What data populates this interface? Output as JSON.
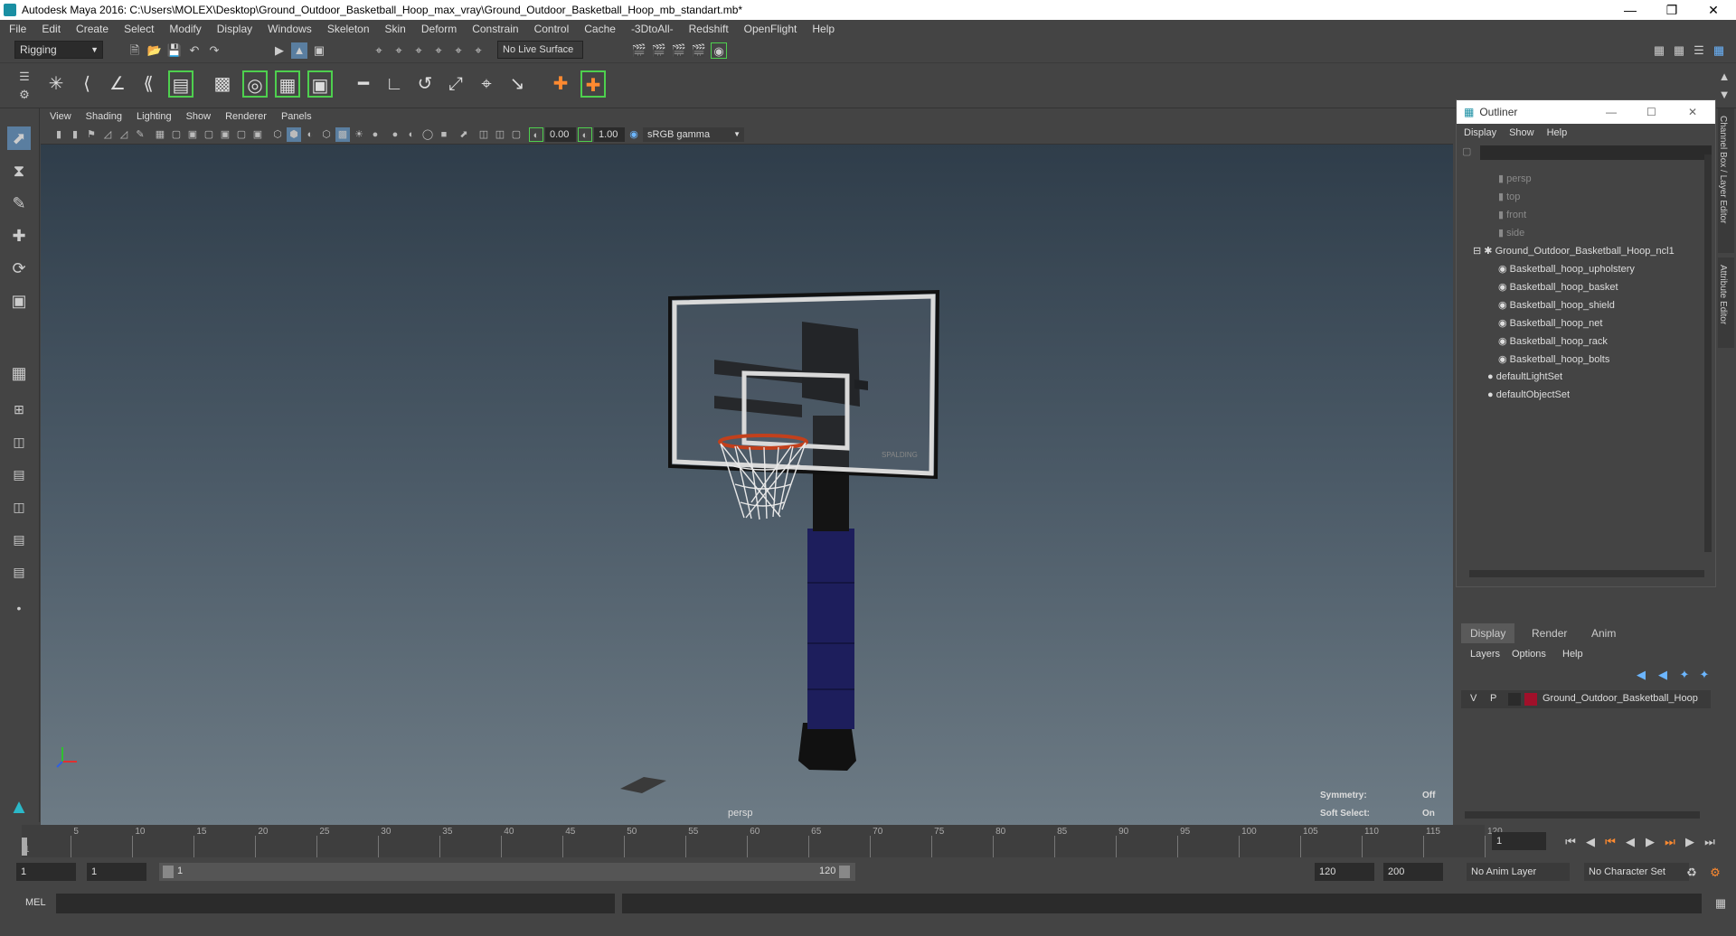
{
  "window": {
    "title": "Autodesk Maya 2016: C:\\Users\\MOLEX\\Desktop\\Ground_Outdoor_Basketball_Hoop_max_vray\\Ground_Outdoor_Basketball_Hoop_mb_standart.mb*"
  },
  "menu": [
    "File",
    "Edit",
    "Create",
    "Select",
    "Modify",
    "Display",
    "Windows",
    "Skeleton",
    "Skin",
    "Deform",
    "Constrain",
    "Control",
    "Cache",
    "-3DtoAll-",
    "Redshift",
    "OpenFlight",
    "Help"
  ],
  "status": {
    "mode": "Rigging",
    "live_surface": "No Live Surface"
  },
  "viewport": {
    "menu": [
      "View",
      "Shading",
      "Lighting",
      "Show",
      "Renderer",
      "Panels"
    ],
    "near_value": "0.00",
    "far_value": "1.00",
    "color_space": "sRGB gamma",
    "camera_label": "persp",
    "symmetry_label": "Symmetry:",
    "symmetry_value": "Off",
    "soft_select_label": "Soft Select:",
    "soft_select_value": "On",
    "backboard_brand": "SPALDING"
  },
  "outliner": {
    "title": "Outliner",
    "menu": [
      "Display",
      "Show",
      "Help"
    ],
    "cameras": [
      "persp",
      "top",
      "front",
      "side"
    ],
    "group": "Ground_Outdoor_Basketball_Hoop_ncl1",
    "children": [
      "Basketball_hoop_upholstery",
      "Basketball_hoop_basket",
      "Basketball_hoop_shield",
      "Basketball_hoop_net",
      "Basketball_hoop_rack",
      "Basketball_hoop_bolts"
    ],
    "sets": [
      "defaultLightSet",
      "defaultObjectSet"
    ]
  },
  "side_tabs": {
    "channel_box": "Channel Box / Layer Editor",
    "attribute_editor": "Attribute Editor"
  },
  "layers": {
    "tabs": [
      "Display",
      "Render",
      "Anim"
    ],
    "menu": [
      "Layers",
      "Options",
      "Help"
    ],
    "row": {
      "v": "V",
      "p": "P",
      "name": "Ground_Outdoor_Basketball_Hoop",
      "color": "#a0102a"
    }
  },
  "timeline": {
    "ticks": [
      "5",
      "10",
      "15",
      "20",
      "25",
      "30",
      "35",
      "40",
      "45",
      "50",
      "55",
      "60",
      "65",
      "70",
      "75",
      "80",
      "85",
      "90",
      "95",
      "100",
      "105",
      "110",
      "115",
      "120"
    ],
    "start_tick": "1",
    "current_frame": "1"
  },
  "range": {
    "start": "1",
    "playback_start": "1",
    "slider_start": "1",
    "slider_end": "120",
    "playback_end": "120",
    "end": "200",
    "anim_layer": "No Anim Layer",
    "character_set": "No Character Set"
  },
  "cmd": {
    "label": "MEL"
  }
}
